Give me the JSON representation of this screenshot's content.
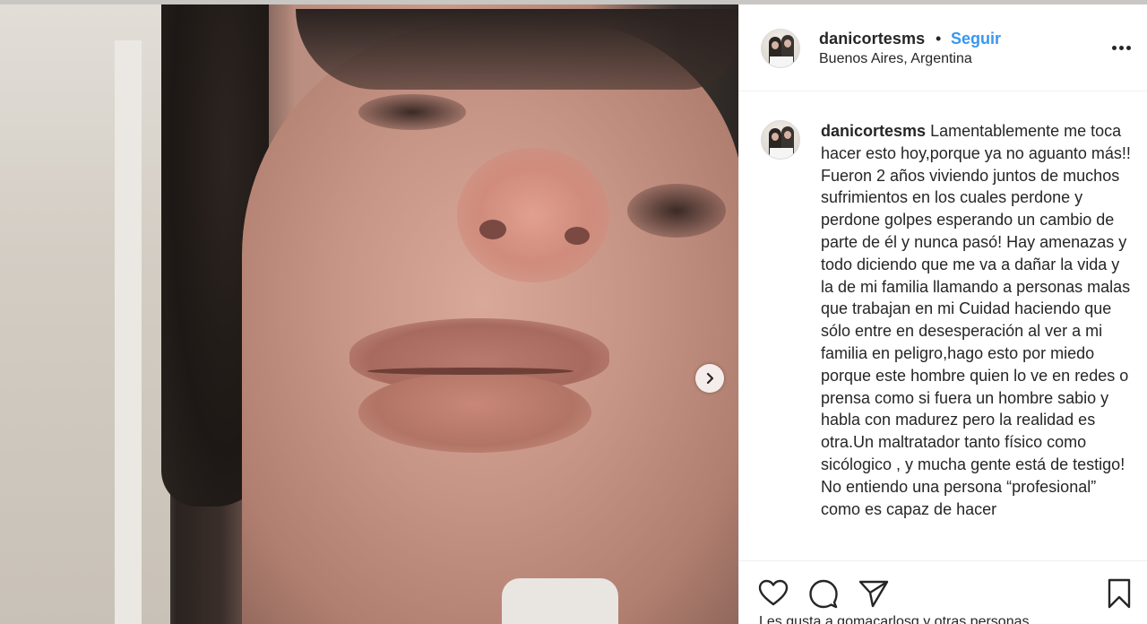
{
  "post": {
    "username": "danicortesms",
    "separator": "•",
    "follow_label": "Seguir",
    "location": "Buenos Aires, Argentina"
  },
  "caption": {
    "username": "danicortesms",
    "text": "Lamentablemente me toca hacer esto hoy,porque ya no aguanto más!! Fueron 2 años viviendo juntos de muchos sufrimientos en los cuales perdone y perdone golpes esperando un cambio de parte de él y nunca pasó! Hay amenazas y todo diciendo que me va a dañar la vida y la de mi familia llamando a personas malas que trabajan en mi Cuidad haciendo que sólo entre en desesperación al ver a mi familia en peligro,hago esto por miedo porque este hombre quien lo ve en redes o prensa como si fuera un hombre sabio y habla con madurez pero la realidad es otra.Un maltratador tanto físico como sicólogico , y mucha gente está de testigo! No entiendo una persona “profesional” como es capaz de hacer"
  },
  "likes": {
    "text": "Les gusta a gomacarlosg y otras personas"
  },
  "icons": {
    "more": "more-options-icon",
    "next": "chevron-right-icon",
    "like": "heart-icon",
    "comment": "comment-icon",
    "share": "send-icon",
    "save": "bookmark-icon"
  },
  "colors": {
    "follow": "#3897f0",
    "text": "#262626",
    "border": "#efefef"
  }
}
